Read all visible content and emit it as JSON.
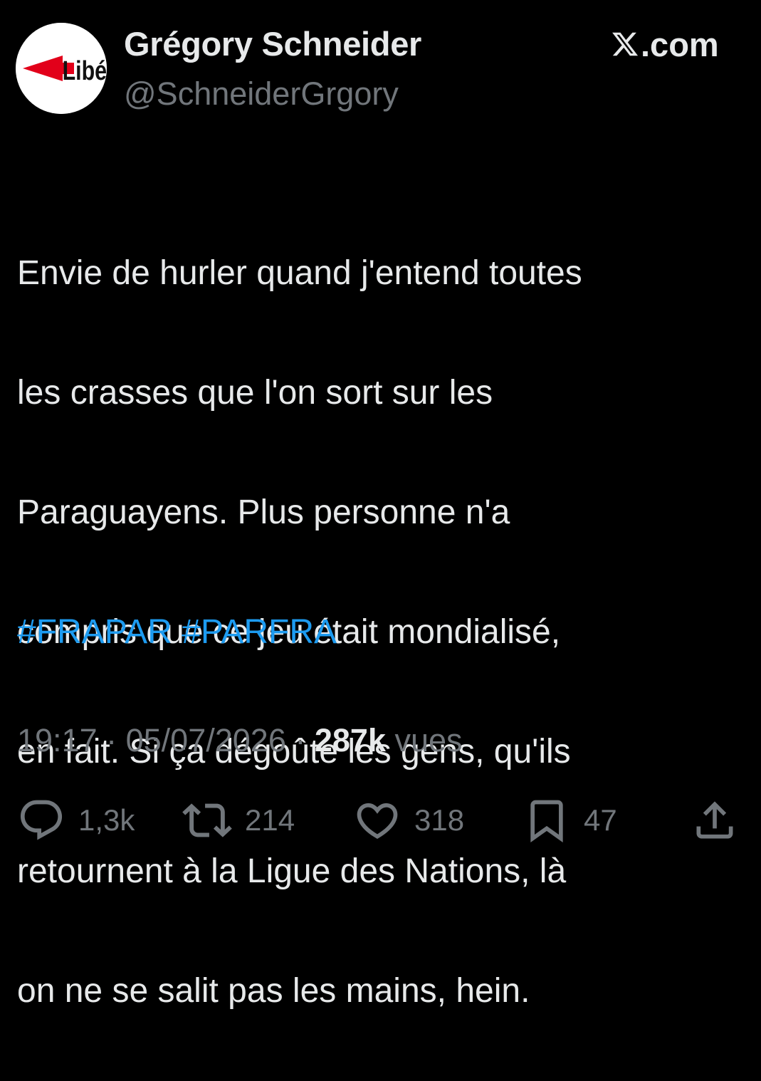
{
  "author": {
    "display_name": "Grégory Schneider",
    "handle": "@SchneiderGrgory",
    "avatar_logo_text": "Libé",
    "avatar_logo_colors": {
      "arrow": "#e2001a",
      "text": "#111111",
      "background": "#ffffff"
    }
  },
  "source_label": ".com",
  "source_icon": "x-logo-icon",
  "tweet": {
    "text_lines": [
      "Envie de hurler quand j'entend toutes",
      "les crasses que l'on sort sur les",
      "Paraguayens. Plus personne n'a",
      "compris que ce jeu était mondialisé,",
      "en fait. Si ça dégoûte les gens, qu'ils",
      "retournent à la Ligue des Nations, là",
      "on ne se salit pas les mains, hein."
    ],
    "hashtags": [
      "#FRAPAR",
      "#PARFRA"
    ]
  },
  "meta": {
    "time": "19:17",
    "separator": " · ",
    "date": "05/07/2026",
    "views_count": "287k",
    "views_label": " vues"
  },
  "actions": {
    "reply": {
      "icon": "reply-icon",
      "count": "1,3k"
    },
    "repost": {
      "icon": "repost-icon",
      "count": "214"
    },
    "like": {
      "icon": "heart-icon",
      "count": "318"
    },
    "bookmark": {
      "icon": "bookmark-icon",
      "count": "47"
    },
    "share": {
      "icon": "share-icon"
    }
  },
  "colors": {
    "background": "#000000",
    "text_primary": "#e7e9ea",
    "text_secondary": "#71767b",
    "link": "#1d9bf0"
  }
}
